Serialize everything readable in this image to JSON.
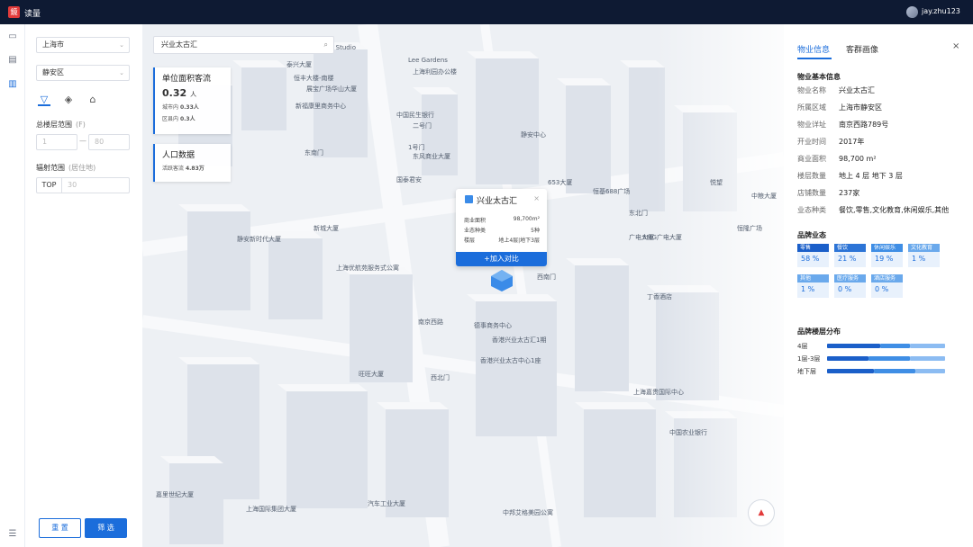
{
  "app": {
    "name": "读量",
    "logo": "鏡",
    "user": "jay.zhu123"
  },
  "rail": [
    {
      "icon": "monitor-icon",
      "glyph": "▭"
    },
    {
      "icon": "document-icon",
      "glyph": "▤"
    },
    {
      "icon": "book-icon",
      "glyph": "▥"
    },
    {
      "icon": "menu-icon",
      "glyph": "☰"
    }
  ],
  "filter": {
    "city": "上海市",
    "district": "静安区",
    "floor_label": "总楼层范围",
    "floor_hint": "(F)",
    "floor_min_placeholder": "1",
    "floor_max_placeholder": "80",
    "radius_label": "辐射范围",
    "radius_hint": "(居住地)",
    "top_tag": "TOP",
    "top_placeholder": "30",
    "reset": "重 置",
    "submit": "筛 选"
  },
  "map": {
    "search_value": "兴业太古汇",
    "flow_card": {
      "title": "单位面积客流",
      "value": "0.32",
      "unit": "人",
      "city_label": "城市内",
      "city_value": "0.33人",
      "district_label": "区县内",
      "district_value": "0.3人"
    },
    "pop_card": {
      "title": "人口数据",
      "label": "活跃客流",
      "value": "4.83万"
    },
    "popup": {
      "title": "兴业太古汇",
      "rows": [
        {
          "k": "商业面积",
          "v": "98,700m²"
        },
        {
          "k": "业态种类",
          "v": "5种"
        },
        {
          "k": "楼层",
          "v": "地上4层|地下3层"
        }
      ],
      "add": "+加入对比"
    },
    "labels": [
      "3501 Art Studio",
      "Lee Gardens",
      "上海利园办公楼",
      "泰兴大厦",
      "恒丰大楼-南楼",
      "展宝广场华山大厦",
      "新福康里商务中心",
      "中国民生银行",
      "二号门",
      "东南门",
      "1号门",
      "东风商业大厦",
      "国泰君安",
      "653大厦",
      "恒基688广场",
      "悦望",
      "东北门",
      "北门",
      "西南门",
      "新城大厦",
      "静安新时代大厦",
      "上海优航苑服务式公寓",
      "南京西路",
      "德事商务中心",
      "香港兴业太古汇1期",
      "香港兴业太古中心1座",
      "旺旺大厦",
      "西北门",
      "中邦艾格美园公寓",
      "上海国际集团大厦",
      "汽车工业大厦",
      "嘉里世纪大厦",
      "中国农业银行",
      "广电大厦",
      "SMG广电大厦",
      "上海嘉贵国际中心",
      "中粮大厦",
      "丁香酒店",
      "静安中心",
      "恒隆广场"
    ],
    "compass": "▲"
  },
  "detail": {
    "tabs": [
      "物业信息",
      "客群画像"
    ],
    "basic_title": "物业基本信息",
    "basic": [
      {
        "k": "物业名称",
        "v": "兴业太古汇"
      },
      {
        "k": "所属区域",
        "v": "上海市静安区"
      },
      {
        "k": "物业详址",
        "v": "南京西路789号"
      },
      {
        "k": "开业时间",
        "v": "2017年"
      },
      {
        "k": "商业面积",
        "v": "98,700 m²"
      },
      {
        "k": "楼层数量",
        "v": "地上 4 层  地下 3 层"
      },
      {
        "k": "店铺数量",
        "v": "237家"
      },
      {
        "k": "业态种类",
        "v": "餐饮,零售,文化教育,休闲娱乐,其他"
      }
    ],
    "brand_title": "品牌业态",
    "brand": [
      {
        "k": "零售",
        "v": "58 %",
        "color": "#1b5fc9"
      },
      {
        "k": "餐饮",
        "v": "21 %",
        "color": "#2c74d6"
      },
      {
        "k": "休闲娱乐",
        "v": "19 %",
        "color": "#3f8ee5"
      },
      {
        "k": "文化教育",
        "v": "1 %",
        "color": "#6aa9ec"
      },
      {
        "k": "其他",
        "v": "1 %",
        "color": "#6aa9ec"
      },
      {
        "k": "医疗服务",
        "v": "0 %",
        "color": "#6aa9ec"
      },
      {
        "k": "酒店服务",
        "v": "0 %",
        "color": "#6aa9ec"
      }
    ],
    "floor_title": "品牌楼层分布",
    "floors": [
      {
        "k": "4层",
        "shares": [
          0.45,
          0.25,
          0.3
        ]
      },
      {
        "k": "1层-3层",
        "shares": [
          0.35,
          0.35,
          0.3
        ]
      },
      {
        "k": "地下层",
        "shares": [
          0.4,
          0.35,
          0.25
        ]
      }
    ]
  }
}
